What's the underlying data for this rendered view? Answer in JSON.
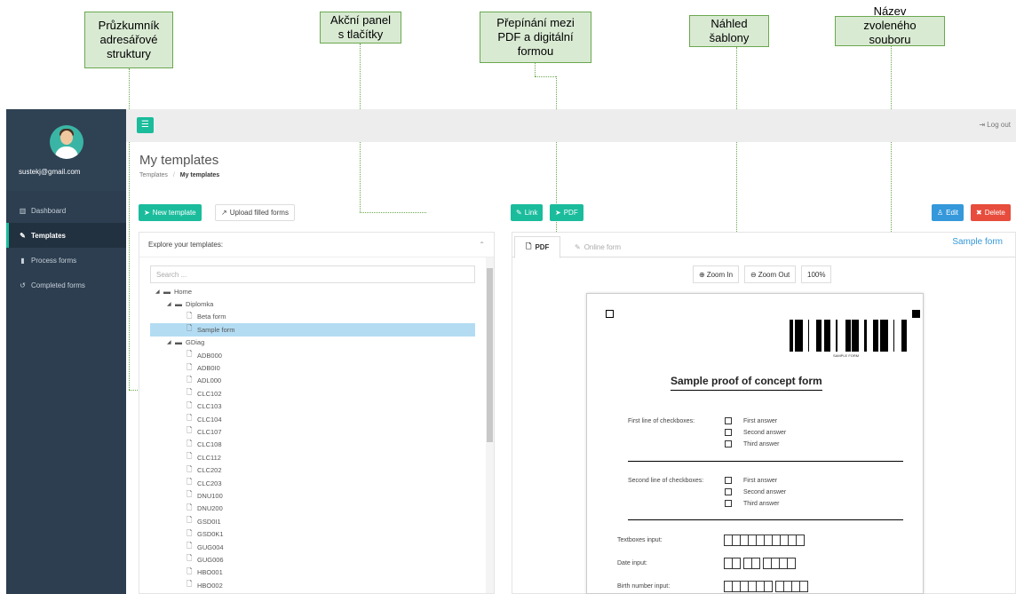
{
  "annotations": [
    {
      "key": "explorer",
      "text": "Průzkumník\nadresářové\nstruktury"
    },
    {
      "key": "action",
      "text": "Akční panel\ns tlačítky"
    },
    {
      "key": "switch",
      "text": "Přepínání mezi\nPDF a digitální\nformou"
    },
    {
      "key": "preview",
      "text": "Náhled\nšablony"
    },
    {
      "key": "filename",
      "text": "Název\nzvoleného\nsouboru"
    }
  ],
  "sidebar": {
    "email": "sustekj@gmail.com",
    "items": [
      {
        "label": "Dashboard",
        "icon": "chart-icon"
      },
      {
        "label": "Templates",
        "icon": "edit-icon"
      },
      {
        "label": "Process forms",
        "icon": "file-icon"
      },
      {
        "label": "Completed forms",
        "icon": "history-icon"
      }
    ]
  },
  "topbar": {
    "logout": "Log out"
  },
  "page": {
    "title": "My templates",
    "breadcrumb_root": "Templates",
    "breadcrumb_sep": "/",
    "breadcrumb_current": "My templates"
  },
  "toolbar": {
    "new_template": "New template",
    "upload": "Upload filled forms",
    "link": "Link",
    "pdf": "PDF",
    "edit": "Edit",
    "delete": "Delete"
  },
  "explorer": {
    "title": "Explore your templates:",
    "search_placeholder": "Search ...",
    "tree": [
      {
        "label": "Home",
        "type": "folder",
        "depth": 0
      },
      {
        "label": "Diplomka",
        "type": "folder",
        "depth": 1
      },
      {
        "label": "Beta form",
        "type": "file",
        "depth": 2
      },
      {
        "label": "Sample form",
        "type": "file",
        "depth": 2,
        "selected": true
      },
      {
        "label": "GDiag",
        "type": "folder",
        "depth": 1
      },
      {
        "label": "ADB000",
        "type": "file",
        "depth": 2
      },
      {
        "label": "ADB0I0",
        "type": "file",
        "depth": 2
      },
      {
        "label": "ADL000",
        "type": "file",
        "depth": 2
      },
      {
        "label": "CLC102",
        "type": "file",
        "depth": 2
      },
      {
        "label": "CLC103",
        "type": "file",
        "depth": 2
      },
      {
        "label": "CLC104",
        "type": "file",
        "depth": 2
      },
      {
        "label": "CLC107",
        "type": "file",
        "depth": 2
      },
      {
        "label": "CLC108",
        "type": "file",
        "depth": 2
      },
      {
        "label": "CLC112",
        "type": "file",
        "depth": 2
      },
      {
        "label": "CLC202",
        "type": "file",
        "depth": 2
      },
      {
        "label": "CLC203",
        "type": "file",
        "depth": 2
      },
      {
        "label": "DNU100",
        "type": "file",
        "depth": 2
      },
      {
        "label": "DNU200",
        "type": "file",
        "depth": 2
      },
      {
        "label": "GSD0I1",
        "type": "file",
        "depth": 2
      },
      {
        "label": "GSD0K1",
        "type": "file",
        "depth": 2
      },
      {
        "label": "GUG004",
        "type": "file",
        "depth": 2
      },
      {
        "label": "GUG006",
        "type": "file",
        "depth": 2
      },
      {
        "label": "HBO001",
        "type": "file",
        "depth": 2
      },
      {
        "label": "HBO002",
        "type": "file",
        "depth": 2
      }
    ]
  },
  "preview": {
    "tab_pdf": "PDF",
    "tab_online": "Online form",
    "file_name": "Sample form",
    "zoom_in": "Zoom In",
    "zoom_out": "Zoom Out",
    "zoom_level": "100%"
  },
  "pdf": {
    "barcode_label": "SAMPLE FORM",
    "title": "Sample proof of concept form",
    "line1_label": "First line of checkboxes:",
    "line2_label": "Second line of checkboxes:",
    "answers": [
      "First answer",
      "Second answer",
      "Third answer"
    ],
    "textboxes_label": "Textboxes input:",
    "date_label": "Date input:",
    "birth_label": "Birth number input:"
  },
  "colors": {
    "accent": "#1abc9c",
    "sidebar": "#2c3e50",
    "link": "#3498db",
    "danger": "#e74c3c",
    "callout": "#d9ead3"
  }
}
